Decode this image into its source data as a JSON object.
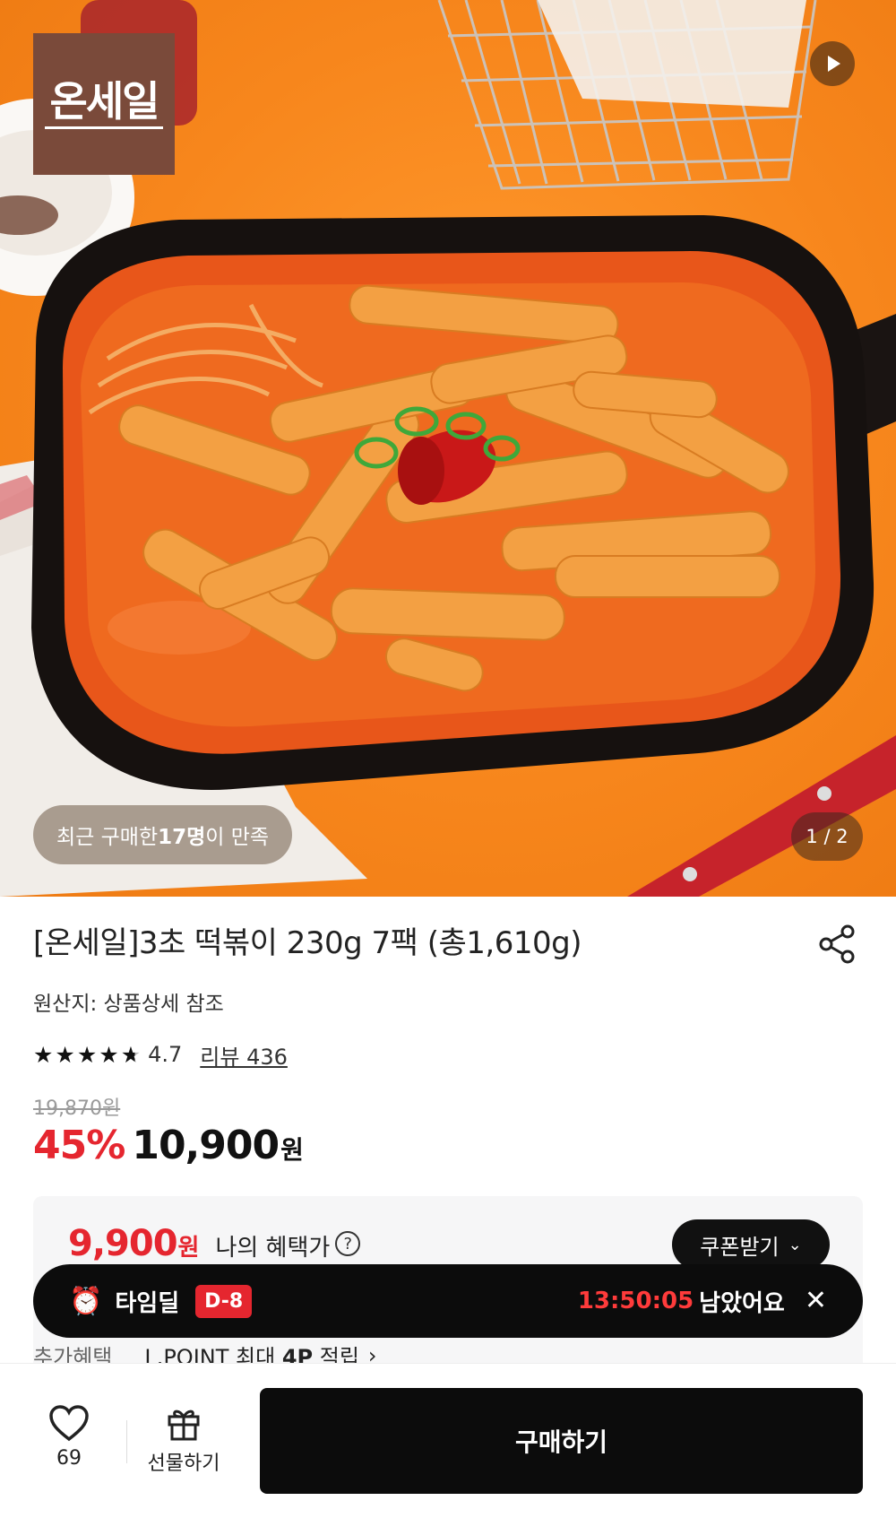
{
  "hero": {
    "brand_logo_text": "온세일",
    "recent_pill": {
      "prefix": "최근 구매한 ",
      "count": "17명",
      "suffix": "이 만족"
    },
    "page_indicator": "1 / 2",
    "video_icon": "play-icon"
  },
  "product": {
    "title": "[온세일]3초 떡볶이 230g 7팩 (총1,610g)",
    "origin": "원산지: 상품상세 참조",
    "rating": {
      "stars": 4.7,
      "value": "4.7",
      "review_label": "리뷰 436"
    },
    "original_price": "19,870원",
    "discount": "45%",
    "sale_price": "10,900",
    "currency": "원"
  },
  "benefit": {
    "price": "9,900",
    "currency": "원",
    "label": "나의 혜택가",
    "help_icon": "?",
    "coupon_button": "쿠폰받기",
    "extra_label": "추가혜택",
    "extra_value_prefix": "L.POINT 최대 ",
    "extra_value_bold": "4P",
    "extra_value_suffix": " 적립"
  },
  "timedeal": {
    "icon": "alarm-clock-icon",
    "label": "타임딜",
    "dday": "D-8",
    "countdown": "13:50:05",
    "remaining": "남았어요",
    "close": "✕"
  },
  "bottom_bar": {
    "like_count": "69",
    "gift_label": "선물하기",
    "buy_label": "구매하기"
  },
  "colors": {
    "accent_red": "#e5262f",
    "dark": "#0c0c0c",
    "hero_orange": "#f7861c",
    "logo_brown": "#7a4a3a"
  }
}
